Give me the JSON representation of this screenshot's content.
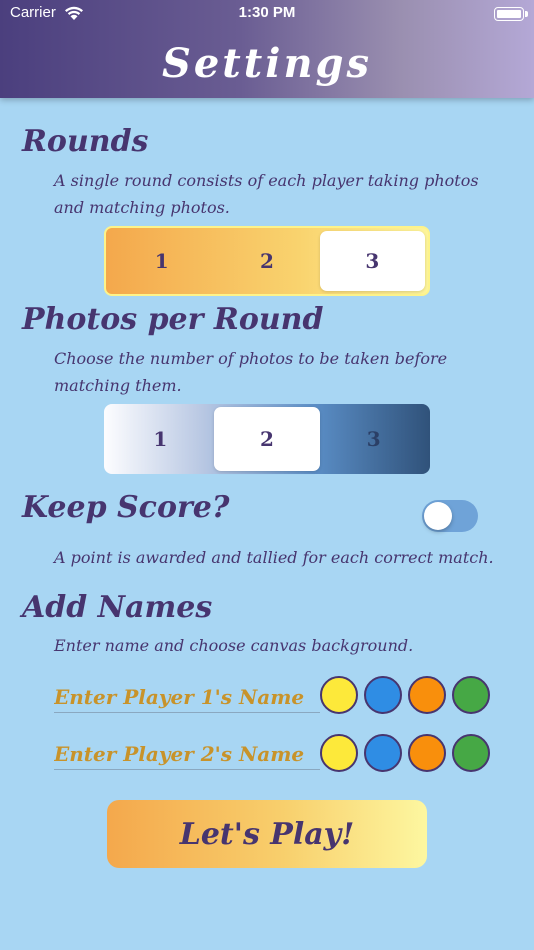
{
  "status_bar": {
    "carrier": "Carrier",
    "time": "1:30 PM"
  },
  "header": {
    "title": "Settings"
  },
  "rounds": {
    "title": "Rounds",
    "description": "A single round consists of each player taking photos and matching photos.",
    "options": [
      "1",
      "2",
      "3"
    ],
    "selected": "3"
  },
  "photos": {
    "title": "Photos per Round",
    "description": "Choose the number of photos to be taken before matching them.",
    "options": [
      "1",
      "2",
      "3"
    ],
    "selected": "2"
  },
  "keep_score": {
    "title": "Keep Score?",
    "description": "A point is awarded and tallied for each correct match.",
    "enabled": false
  },
  "names": {
    "title": "Add Names",
    "description": "Enter name and choose canvas background.",
    "players": [
      {
        "placeholder": "Enter Player 1's Name"
      },
      {
        "placeholder": "Enter Player 2's Name"
      }
    ],
    "colors": [
      "#fde93a",
      "#2f8de4",
      "#f98f0c",
      "#46a845"
    ]
  },
  "play_button": {
    "label": "Let's Play!"
  }
}
